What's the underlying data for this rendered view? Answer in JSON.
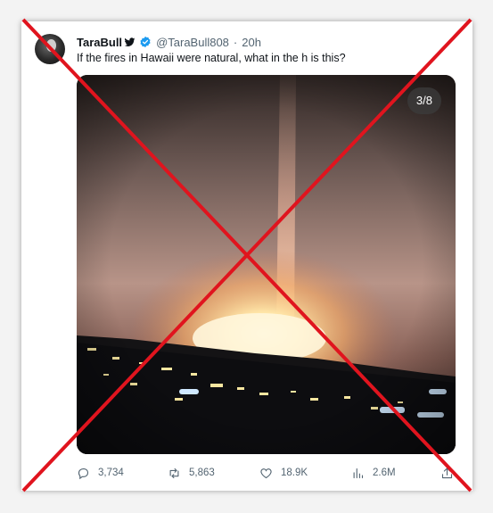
{
  "tweet": {
    "author_name": "TaraBull",
    "handle": "@TaraBull808",
    "time_separator": "·",
    "time": "20h",
    "text": "If the fires in Hawaii were natural, what in the h is this?",
    "media_counter": "3/8"
  },
  "actions": {
    "replies": "3,734",
    "retweets": "5,863",
    "likes": "18.9K",
    "views": "2.6M"
  },
  "colors": {
    "cross": "#e0141e",
    "verified": "#1d9bf0",
    "muted_text": "#536471"
  },
  "icons": [
    "bird-icon",
    "verified-badge-icon",
    "reply-icon",
    "retweet-icon",
    "like-icon",
    "views-icon",
    "share-icon"
  ]
}
